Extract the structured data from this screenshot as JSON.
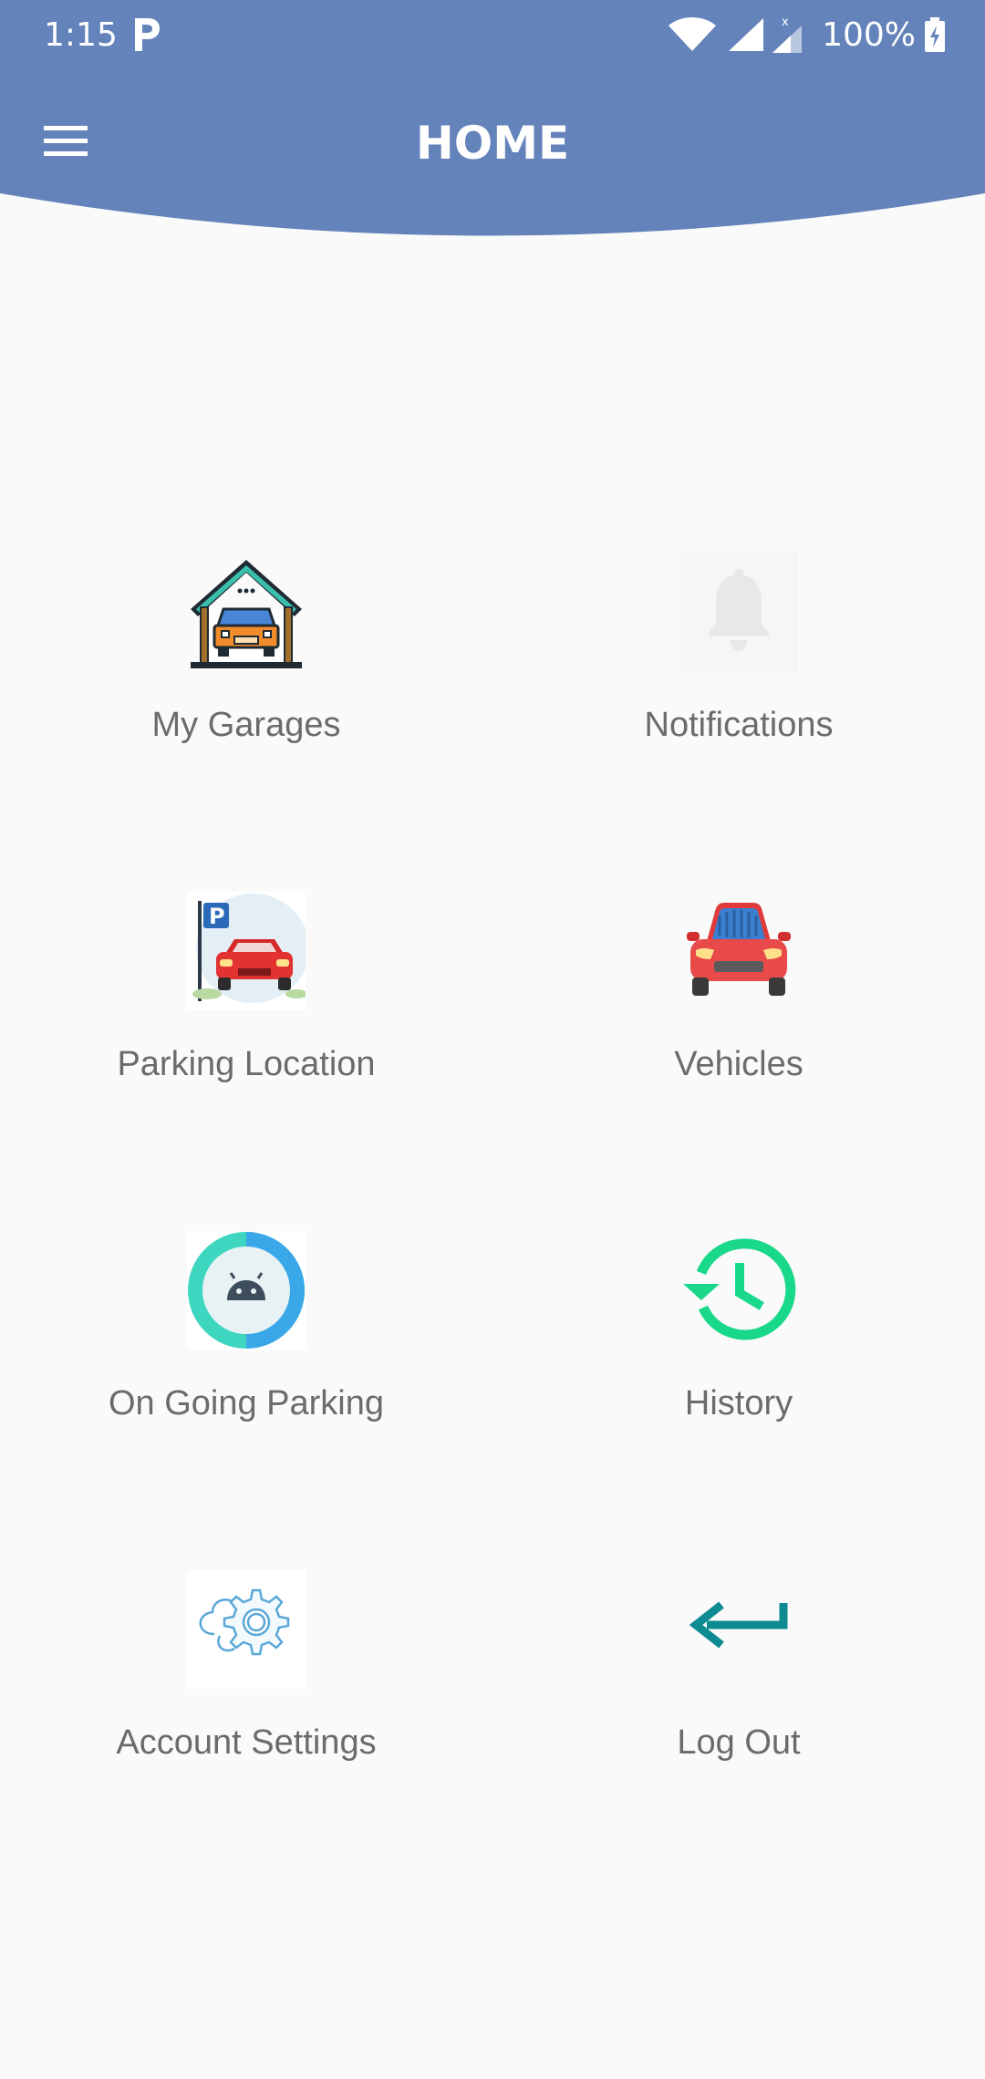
{
  "status_bar": {
    "time": "1:15",
    "battery": "100%",
    "icons": [
      "parking-p-icon",
      "wifi-icon",
      "signal-icon",
      "signal-x-icon",
      "battery-charging-icon"
    ]
  },
  "header": {
    "title": "HOME",
    "menu_icon": "hamburger-menu-icon",
    "color": "#6383ba"
  },
  "menu": {
    "items": [
      {
        "label": "My Garages",
        "icon": "garage-icon"
      },
      {
        "label": "Notifications",
        "icon": "bell-icon"
      },
      {
        "label": "Parking Location",
        "icon": "parking-location-icon"
      },
      {
        "label": "Vehicles",
        "icon": "car-icon"
      },
      {
        "label": "On Going Parking",
        "icon": "android-icon"
      },
      {
        "label": "History",
        "icon": "history-icon"
      },
      {
        "label": "Account Settings",
        "icon": "settings-gear-icon"
      },
      {
        "label": "Log Out",
        "icon": "logout-arrow-icon"
      }
    ]
  },
  "colors": {
    "background": "#fafafa",
    "label": "#6b6b6b",
    "history_green": "#19d88a",
    "logout_teal": "#0e8a92"
  }
}
